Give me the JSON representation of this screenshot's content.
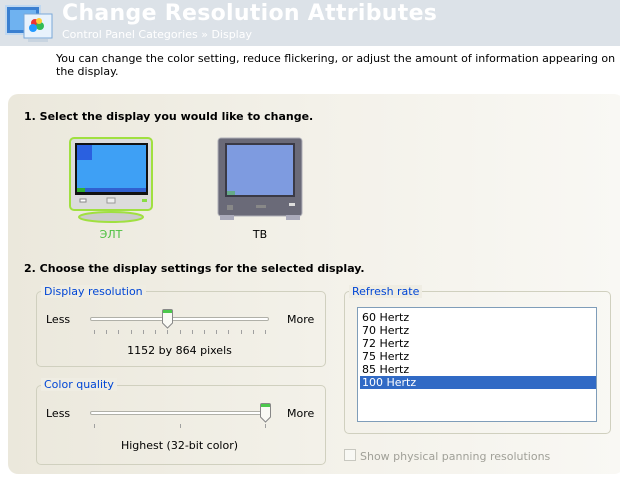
{
  "header": {
    "title": "Change Resolution Attributes",
    "breadcrumb": "Control Panel Categories  »  Display",
    "icon": "display-settings-icon"
  },
  "description": "You can change the color setting, reduce flickering, or adjust the amount of information appearing on the display.",
  "section1": {
    "heading": "1. Select the display you would like to change.",
    "displays": [
      {
        "label": "ЭЛТ",
        "selected": true,
        "icon": "crt-monitor-icon"
      },
      {
        "label": "ТВ",
        "selected": false,
        "icon": "tv-icon"
      }
    ]
  },
  "section2": {
    "heading": "2. Choose the display settings for the selected display."
  },
  "resolution": {
    "legend": "Display resolution",
    "less": "Less",
    "more": "More",
    "value": "1152 by 864 pixels",
    "position": 6,
    "steps": 15
  },
  "color": {
    "legend": "Color quality",
    "less": "Less",
    "more": "More",
    "value": "Highest (32-bit color)",
    "position": 2,
    "steps": 3
  },
  "refresh": {
    "legend": "Refresh rate",
    "items": [
      "60 Hertz",
      "70 Hertz",
      "72 Hertz",
      "75 Hertz",
      "85 Hertz",
      "100 Hertz"
    ],
    "selected_index": 5
  },
  "panning": {
    "label": "Show physical panning resolutions",
    "checked": false,
    "disabled": true
  },
  "colors": {
    "accent": "#316ac5",
    "legend": "#0046d5",
    "selected_display": "#4ec040"
  }
}
